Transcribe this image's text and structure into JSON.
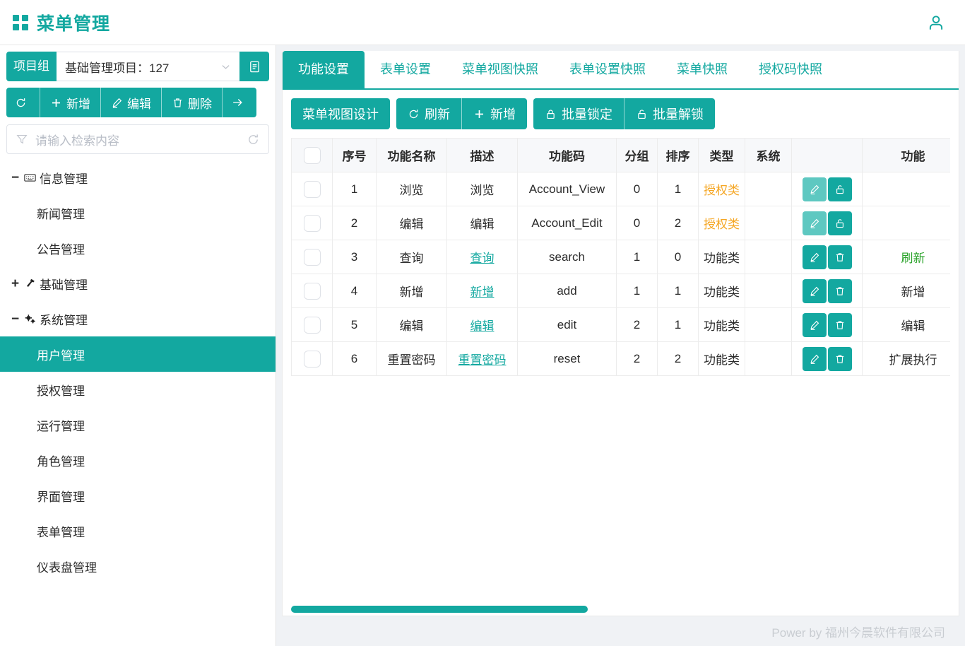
{
  "header": {
    "title": "菜单管理",
    "grid_icon": "grid-icon",
    "user_icon": "user-icon",
    "accent_color": "#13a8a0"
  },
  "sidebar": {
    "project": {
      "tag_label": "项目组",
      "selected": "基础管理项目：127",
      "chevron_icon": "chevron-down-icon",
      "doc_icon": "document-icon"
    },
    "toolbar": [
      {
        "label": "",
        "icon": "refresh-icon",
        "name": "refresh-button"
      },
      {
        "label": "新增",
        "icon": "plus-icon",
        "name": "add-button"
      },
      {
        "label": "编辑",
        "icon": "pencil-icon",
        "name": "edit-button"
      },
      {
        "label": "删除",
        "icon": "trash-icon",
        "name": "delete-button"
      },
      {
        "label": "",
        "icon": "arrow-right-icon",
        "name": "expand-button"
      }
    ],
    "search": {
      "placeholder": "请输入检索内容",
      "value": "",
      "filter_icon": "filter-icon",
      "refresh_icon": "refresh-icon"
    },
    "tree": [
      {
        "label": "信息管理",
        "toggle": "−",
        "icon": "keyboard-icon",
        "level": 0,
        "active": false
      },
      {
        "label": "新闻管理",
        "toggle": "",
        "icon": "",
        "level": 1,
        "active": false
      },
      {
        "label": "公告管理",
        "toggle": "",
        "icon": "",
        "level": 1,
        "active": false
      },
      {
        "label": "基础管理",
        "toggle": "+",
        "icon": "hammer-icon",
        "level": 0,
        "active": false
      },
      {
        "label": "系统管理",
        "toggle": "−",
        "icon": "gears-icon",
        "level": 0,
        "active": false
      },
      {
        "label": "用户管理",
        "toggle": "",
        "icon": "",
        "level": 1,
        "active": true
      },
      {
        "label": "授权管理",
        "toggle": "",
        "icon": "",
        "level": 1,
        "active": false
      },
      {
        "label": "运行管理",
        "toggle": "",
        "icon": "",
        "level": 1,
        "active": false
      },
      {
        "label": "角色管理",
        "toggle": "",
        "icon": "",
        "level": 1,
        "active": false
      },
      {
        "label": "界面管理",
        "toggle": "",
        "icon": "",
        "level": 1,
        "active": false
      },
      {
        "label": "表单管理",
        "toggle": "",
        "icon": "",
        "level": 1,
        "active": false
      },
      {
        "label": "仪表盘管理",
        "toggle": "",
        "icon": "",
        "level": 1,
        "active": false
      }
    ]
  },
  "main": {
    "tabs": [
      {
        "label": "功能设置",
        "active": true
      },
      {
        "label": "表单设置",
        "active": false
      },
      {
        "label": "菜单视图快照",
        "active": false
      },
      {
        "label": "表单设置快照",
        "active": false
      },
      {
        "label": "菜单快照",
        "active": false
      },
      {
        "label": "授权码快照",
        "active": false
      }
    ],
    "toolbar": [
      {
        "label": "菜单视图设计",
        "icon": "",
        "name": "menu-view-design-button"
      },
      {
        "label": "刷新",
        "icon": "refresh-icon",
        "name": "refresh-button"
      },
      {
        "label": "新增",
        "icon": "plus-icon",
        "name": "add-button"
      },
      {
        "label": "批量锁定",
        "icon": "lock-icon",
        "name": "batch-lock-button"
      },
      {
        "label": "批量解锁",
        "icon": "unlock-icon",
        "name": "batch-unlock-button"
      }
    ],
    "table": {
      "columns": [
        "",
        "序号",
        "功能名称",
        "描述",
        "功能码",
        "分组",
        "排序",
        "类型",
        "系统",
        "",
        "功能"
      ],
      "rows": [
        {
          "index": "1",
          "name": "浏览",
          "desc": "浏览",
          "desc_link": false,
          "code": "Account_View",
          "group": "0",
          "order": "1",
          "type": "授权类",
          "type_style": "auth",
          "system": "",
          "ops": [
            "pencil-icon",
            "unlock-icon"
          ],
          "ops_style": "lock",
          "func": "",
          "func_style": ""
        },
        {
          "index": "2",
          "name": "编辑",
          "desc": "编辑",
          "desc_link": false,
          "code": "Account_Edit",
          "group": "0",
          "order": "2",
          "type": "授权类",
          "type_style": "auth",
          "system": "",
          "ops": [
            "pencil-icon",
            "unlock-icon"
          ],
          "ops_style": "lock",
          "func": "",
          "func_style": ""
        },
        {
          "index": "3",
          "name": "查询",
          "desc": "查询",
          "desc_link": true,
          "code": "search",
          "group": "1",
          "order": "0",
          "type": "功能类",
          "type_style": "",
          "system": "",
          "ops": [
            "pencil-icon",
            "trash-icon"
          ],
          "ops_style": "del",
          "func": "刷新",
          "func_style": "grn"
        },
        {
          "index": "4",
          "name": "新增",
          "desc": "新增",
          "desc_link": true,
          "code": "add",
          "group": "1",
          "order": "1",
          "type": "功能类",
          "type_style": "",
          "system": "",
          "ops": [
            "pencil-icon",
            "trash-icon"
          ],
          "ops_style": "del",
          "func": "新增",
          "func_style": ""
        },
        {
          "index": "5",
          "name": "编辑",
          "desc": "编辑",
          "desc_link": true,
          "code": "edit",
          "group": "2",
          "order": "1",
          "type": "功能类",
          "type_style": "",
          "system": "",
          "ops": [
            "pencil-icon",
            "trash-icon"
          ],
          "ops_style": "del",
          "func": "编辑",
          "func_style": ""
        },
        {
          "index": "6",
          "name": "重置密码",
          "desc": "重置密码",
          "desc_link": true,
          "code": "reset",
          "group": "2",
          "order": "2",
          "type": "功能类",
          "type_style": "",
          "system": "",
          "ops": [
            "pencil-icon",
            "trash-icon"
          ],
          "ops_style": "del",
          "func": "扩展执行",
          "func_style": ""
        }
      ]
    }
  },
  "footer": {
    "text": "Power by 福州今晨软件有限公司"
  }
}
